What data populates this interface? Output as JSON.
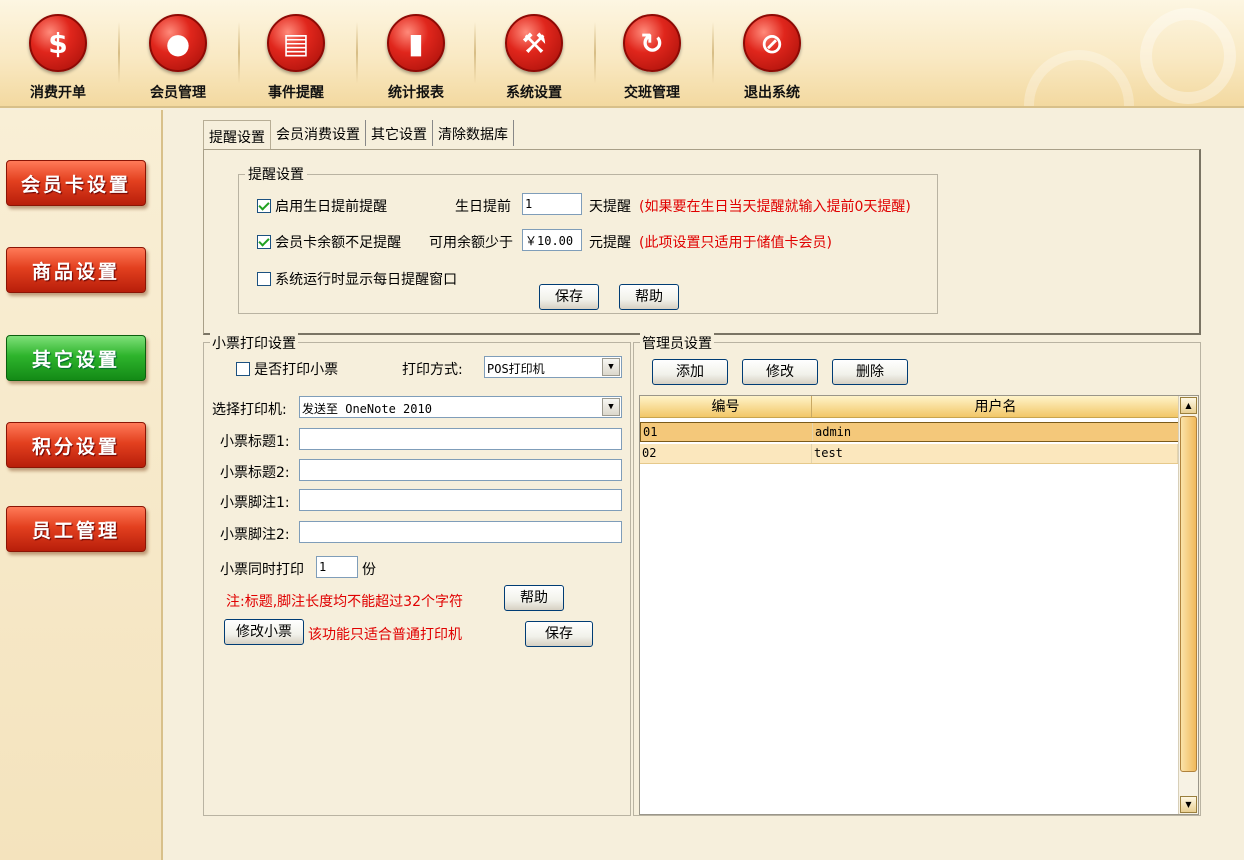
{
  "toolbar": {
    "items": [
      {
        "label": "消费开单",
        "icon": "$"
      },
      {
        "label": "会员管理",
        "icon": "●"
      },
      {
        "label": "事件提醒",
        "icon": "▤"
      },
      {
        "label": "统计报表",
        "icon": "▮"
      },
      {
        "label": "系统设置",
        "icon": "⚒"
      },
      {
        "label": "交班管理",
        "icon": "↻"
      },
      {
        "label": "退出系统",
        "icon": "⊘"
      }
    ]
  },
  "sidebar": {
    "items": [
      {
        "label": "会员卡设置"
      },
      {
        "label": "商品设置"
      },
      {
        "label": "其它设置"
      },
      {
        "label": "积分设置"
      },
      {
        "label": "员工管理"
      }
    ]
  },
  "tabs": [
    "提醒设置",
    "会员消费设置",
    "其它设置",
    "清除数据库"
  ],
  "reminder": {
    "group_title": "提醒设置",
    "birthday_check_label": "启用生日提前提醒",
    "birthday_before_label": "生日提前",
    "birthday_days": "1",
    "birthday_days_unit": "天提醒",
    "birthday_note": "(如果要在生日当天提醒就输入提前0天提醒)",
    "balance_check_label": "会员卡余额不足提醒",
    "balance_less_label": "可用余额少于",
    "balance_value": "￥10.00",
    "balance_unit": "元提醒",
    "balance_note": "(此项设置只适用于储值卡会员)",
    "daily_check_label": "系统运行时显示每日提醒窗口",
    "save_label": "保存",
    "help_label": "帮助"
  },
  "receipt": {
    "title": "小票打印设置",
    "print_check_label": "是否打印小票",
    "print_mode_label": "打印方式:",
    "print_mode_value": "POS打印机",
    "printer_label": "选择打印机:",
    "printer_value": "发送至 OneNote 2010",
    "title1_label": "小票标题1:",
    "title2_label": "小票标题2:",
    "footer1_label": "小票脚注1:",
    "footer2_label": "小票脚注2:",
    "copies_label": "小票同时打印",
    "copies_value": "1",
    "copies_unit": "份",
    "note": "注:标题,脚注长度均不能超过32个字符",
    "help_label": "帮助",
    "modify_label": "修改小票",
    "modify_note": "该功能只适合普通打印机",
    "save_label": "保存"
  },
  "admin": {
    "title": "管理员设置",
    "add_label": "添加",
    "edit_label": "修改",
    "delete_label": "删除",
    "columns": [
      "编号",
      "用户名"
    ],
    "rows": [
      {
        "id": "01",
        "username": "admin"
      },
      {
        "id": "02",
        "username": "test"
      }
    ]
  }
}
